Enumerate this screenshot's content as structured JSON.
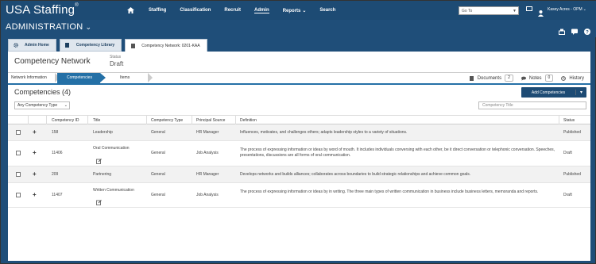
{
  "topnav": {
    "logo": "USA Staffing",
    "logo_mark": "®",
    "items": [
      {
        "label": "Staffing"
      },
      {
        "label": "Classification"
      },
      {
        "label": "Recruit"
      },
      {
        "label": "Admin"
      },
      {
        "label": "Reports"
      },
      {
        "label": "Search"
      }
    ],
    "goto_placeholder": "Go To",
    "user_name": "Kasey Acres - OPM"
  },
  "admin": {
    "title": "ADMINISTRATION"
  },
  "tabs": [
    {
      "label": "Admin Home",
      "icon": "gear-icon"
    },
    {
      "label": "Competency Library",
      "icon": "document-icon"
    },
    {
      "label": "Competency Network: 0201-KAA",
      "icon": "document-icon"
    }
  ],
  "page": {
    "title": "Competency Network",
    "status_label": "Status",
    "status_value": "Draft"
  },
  "steps": [
    "Network Information",
    "Competencies",
    "Items"
  ],
  "right_links": {
    "documents": {
      "label": "Documents",
      "count": "2"
    },
    "notes": {
      "label": "Notes",
      "count": "0"
    },
    "history": {
      "label": "History"
    }
  },
  "section": {
    "title": "Competencies (4)",
    "add_button": "Add Competencies",
    "filter_value": "Any Competency Type",
    "search_placeholder": "Competency Title"
  },
  "table": {
    "headers": {
      "id": "Competency ID",
      "title": "Title",
      "type": "Competency Type",
      "source": "Principal Source",
      "definition": "Definition",
      "status": "Status"
    },
    "rows": [
      {
        "id": "158",
        "title": "Leadership",
        "type": "General",
        "source": "HR Manager",
        "definition": "Influences, motivates, and challenges others; adapts leadership styles to a variety of situations.",
        "status": "Published"
      },
      {
        "id": "11406",
        "title": "Oral Communication",
        "type": "General",
        "source": "Job Analysis",
        "definition": "The process of expressing information or ideas by word of mouth. It includes individuals conversing with each other, be it direct conversation or telephonic conversation. Speeches, presentations, discussions are all forms of oral communication.",
        "status": "Draft"
      },
      {
        "id": "209",
        "title": "Partnering",
        "type": "General",
        "source": "HR Manager",
        "definition": "Develops networks and builds alliances; collaborates across boundaries to build strategic relationships and achieve common goals.",
        "status": "Published"
      },
      {
        "id": "11407",
        "title": "Written Communication",
        "type": "General",
        "source": "Job Analysis",
        "definition": "The process of expressing information or ideas by in writing. The three main types of written communication in business include business letters, memoranda and reports.",
        "status": "Draft"
      }
    ]
  }
}
